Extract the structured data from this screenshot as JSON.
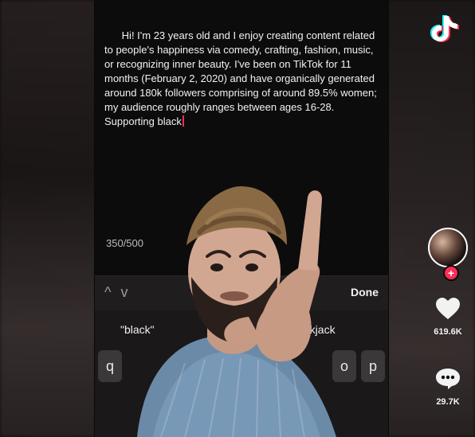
{
  "caption": {
    "text": "Hi! I'm 23 years old and I enjoy creating content related to people's happiness via comedy, crafting, fashion, music, or recognizing inner beauty. I've been on TikTok for 11 months (February 2, 2020) and have organically generated around 180k followers comprising of around 89.5% women; my audience roughly ranges between ages 16-28. Supporting black",
    "char_count": "350/500"
  },
  "keyboard": {
    "done_label": "Done",
    "suggest_left": "\"black\"",
    "suggest_right": "blackjack",
    "visible_keys": [
      "q",
      "o",
      "p"
    ]
  },
  "rail": {
    "likes": "619.6K",
    "comments": "29.7K"
  },
  "icons": {
    "brand": "tiktok-icon",
    "like": "heart-icon",
    "comment": "comment-icon",
    "follow": "plus-icon",
    "nav": [
      "chevron-up-icon",
      "chevron-down-icon"
    ]
  },
  "colors": {
    "accent": "#ff2d55",
    "tiktok_cyan": "#25f4ee"
  }
}
